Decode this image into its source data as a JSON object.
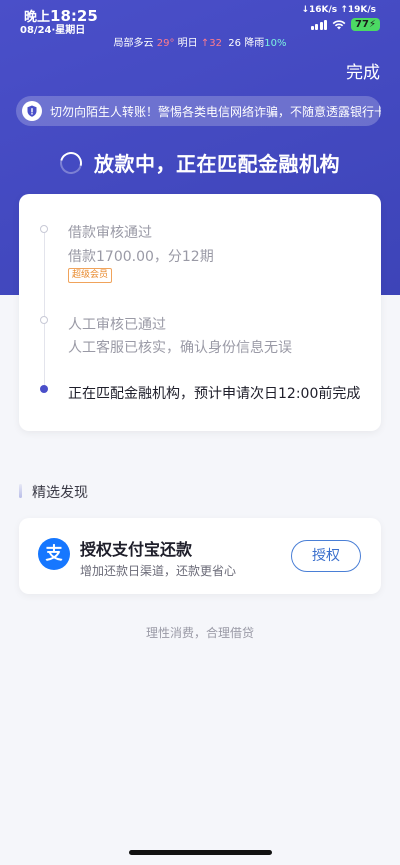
{
  "status_bar": {
    "period": "晚上",
    "time": "18:25",
    "date": "08/24·星期日",
    "net_down": "↓16K/s",
    "net_up": "↑19K/s",
    "battery": "77"
  },
  "weather": {
    "today": "局部多云",
    "today_temp": "29°",
    "tomorrow_label": "明日",
    "tomorrow_temp": "↑32",
    "low_temp": "26",
    "rain_label": "降雨",
    "rain_prob": "10%"
  },
  "header": {
    "done_label": "完成"
  },
  "notice": {
    "text": "切勿向陌生人转账！警惕各类电信网络诈骗，不随意透露银行卡信息"
  },
  "loan_status": {
    "text": "放款中，正在匹配金融机构"
  },
  "timeline": {
    "step1_title": "借款审核通过",
    "step1_detail": "借款1700.00，分12期",
    "step1_badge": "超级会员",
    "step2_title": "人工审核已通过",
    "step2_detail": "人工客服已核实，确认身份信息无误",
    "step3_title": "正在匹配金融机构，预计申请次日12:00前完成"
  },
  "discover": {
    "section_title": "精选发现",
    "card_icon_glyph": "支",
    "card_title": "授权支付宝还款",
    "card_subtitle": "增加还款日渠道，还款更省心",
    "card_button": "授权"
  },
  "footer": {
    "note": "理性消费，合理借贷"
  },
  "colors": {
    "hero": "#4a4fc9",
    "accent": "#4a4fc9",
    "badge": "#e8892c",
    "alipay": "#1677ff"
  }
}
